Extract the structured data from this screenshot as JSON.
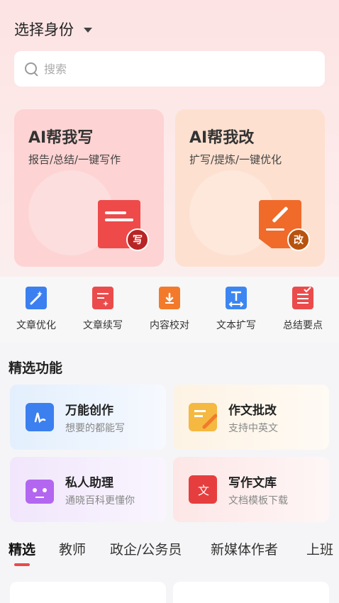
{
  "header": {
    "identity_label": "选择身份"
  },
  "search": {
    "placeholder": "搜索"
  },
  "cards": [
    {
      "title": "AI帮我写",
      "subtitle": "报告/总结/一键写作",
      "badge": "写"
    },
    {
      "title": "AI帮我改",
      "subtitle": "扩写/提炼/一键优化",
      "badge": "改"
    }
  ],
  "tools": [
    {
      "label": "文章优化",
      "icon": "magic-wand-icon"
    },
    {
      "label": "文章续写",
      "icon": "doc-continue-icon"
    },
    {
      "label": "内容校对",
      "icon": "proofread-icon"
    },
    {
      "label": "文本扩写",
      "icon": "text-expand-icon"
    },
    {
      "label": "总结要点",
      "icon": "summary-icon"
    }
  ],
  "featured": {
    "title": "精选功能",
    "items": [
      {
        "title": "万能创作",
        "subtitle": "想要的都能写"
      },
      {
        "title": "作文批改",
        "subtitle": "支持中英文"
      },
      {
        "title": "私人助理",
        "subtitle": "通晓百科更懂你"
      },
      {
        "title": "写作文库",
        "subtitle": "文档模板下载"
      }
    ]
  },
  "tabs": [
    "精选",
    "教师",
    "政企/公务员",
    "新媒体作者",
    "上班"
  ],
  "colors": {
    "accent": "#e84a4a",
    "card_write": "#fdd3d3",
    "card_edit": "#fde0cf"
  }
}
